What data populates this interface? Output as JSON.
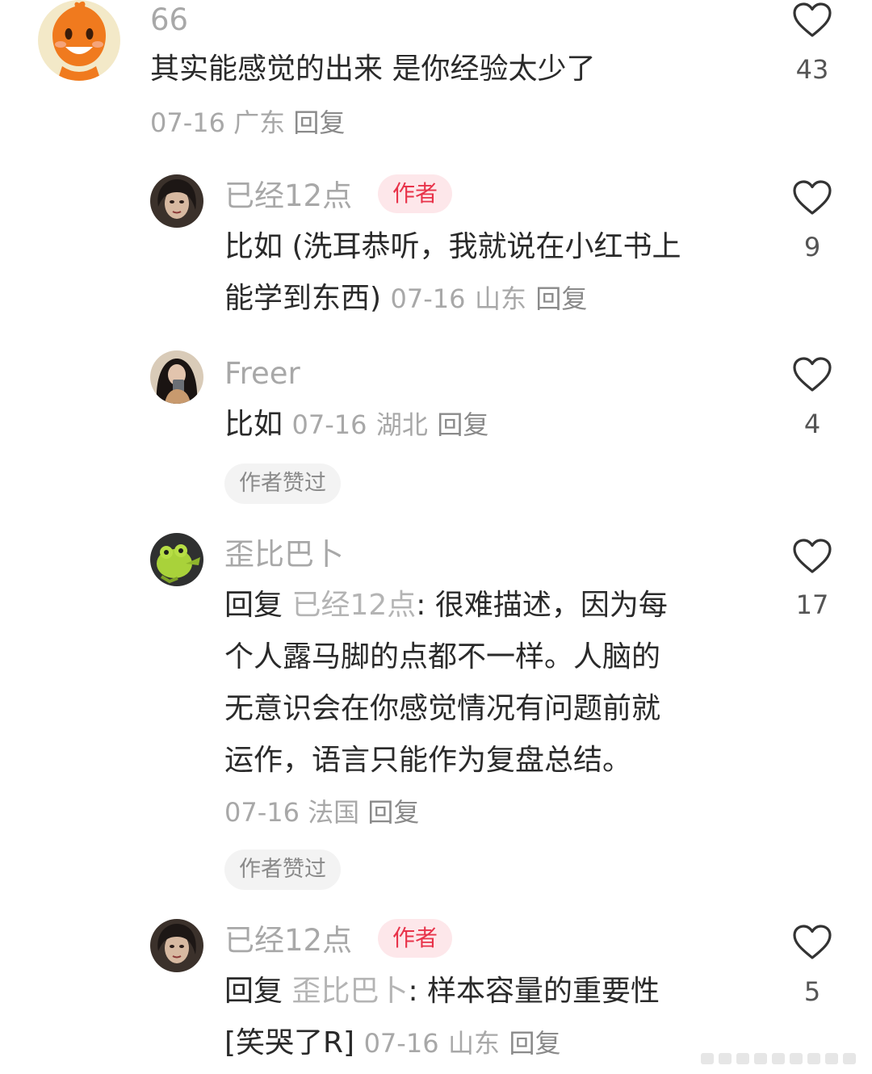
{
  "comments": [
    {
      "user": "66",
      "lines": [
        "其实能感觉的出来 是你经验太少了"
      ],
      "meta": {
        "date": "07-16",
        "location": "广东",
        "reply": "回复"
      },
      "likes": "43"
    },
    {
      "user": "已经12点",
      "badge": "作者",
      "lines": [
        "比如 (洗耳恭听，我就说在小红书上",
        "能学到东西)"
      ],
      "meta": {
        "date": "07-16",
        "location": "山东",
        "reply": "回复"
      },
      "likes": "9"
    },
    {
      "user": "Freer",
      "lines": [
        "比如"
      ],
      "meta": {
        "date": "07-16",
        "location": "湖北",
        "reply": "回复"
      },
      "liked_tag": "作者赞过",
      "likes": "4"
    },
    {
      "user": "歪比巴卜",
      "reply_prefix": "回复",
      "reply_to": "已经12点",
      "lines": [
        ": 很难描述，因为每",
        "个人露马脚的点都不一样。人脑的",
        "无意识会在你感觉情况有问题前就",
        "运作，语言只能作为复盘总结。"
      ],
      "meta": {
        "date": "07-16",
        "location": "法国",
        "reply": "回复"
      },
      "liked_tag": "作者赞过",
      "likes": "17"
    },
    {
      "user": "已经12点",
      "badge": "作者",
      "reply_prefix": "回复",
      "reply_to": "歪比巴卜",
      "lines": [
        ": 样本容量的重要性",
        "[笑哭了R]"
      ],
      "meta": {
        "date": "07-16",
        "location": "山东",
        "reply": "回复"
      },
      "likes": "5"
    }
  ],
  "colors": {
    "accent": "#e8334a",
    "muted": "#a8a8a8",
    "text": "#2a2a2a",
    "badge_bg": "#fde7ea",
    "pill_bg": "#f3f3f3"
  },
  "icons": {
    "like": "heart-outline-icon"
  }
}
